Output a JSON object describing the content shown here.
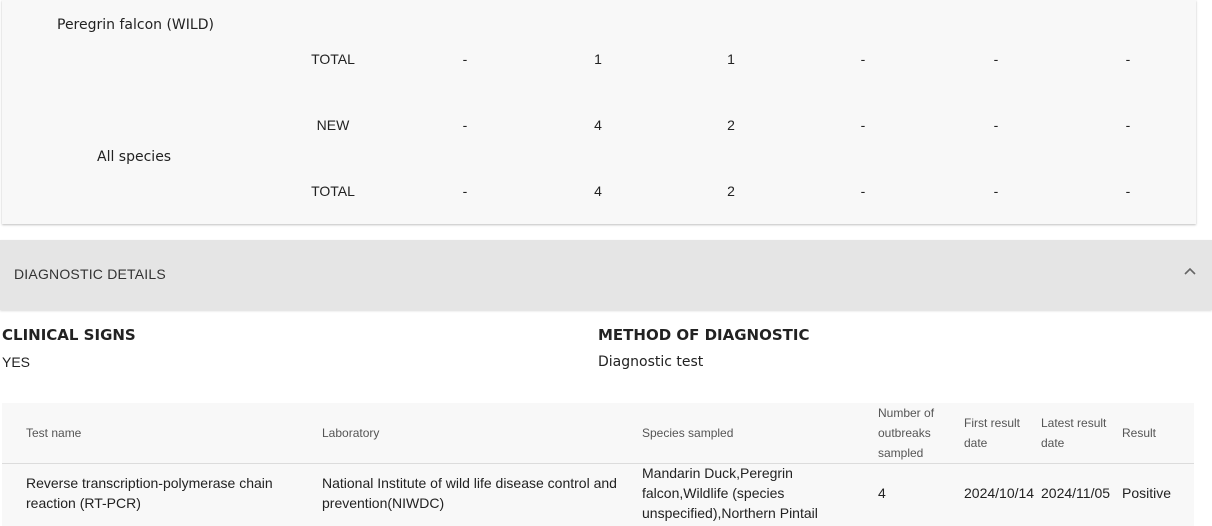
{
  "outbreak_table": {
    "rows": [
      {
        "species": "Peregrin falcon (WILD)",
        "type": "TOTAL",
        "values": [
          "-",
          "1",
          "1",
          "-",
          "-",
          "-"
        ]
      },
      {
        "species": "All species",
        "type": "NEW",
        "values": [
          "-",
          "4",
          "2",
          "-",
          "-",
          "-"
        ]
      },
      {
        "species": "",
        "type": "TOTAL",
        "values": [
          "-",
          "4",
          "2",
          "-",
          "-",
          "-"
        ]
      }
    ]
  },
  "diagnostic": {
    "section_title": "DIAGNOSTIC DETAILS",
    "expanded": true,
    "clinical_signs_label": "CLINICAL SIGNS",
    "clinical_signs_value": "YES",
    "method_label": "METHOD OF DIAGNOSTIC",
    "method_value": "Diagnostic test",
    "table": {
      "headers": {
        "test_name": "Test name",
        "laboratory": "Laboratory",
        "species_sampled": "Species sampled",
        "num_outbreaks_1": "Number of",
        "num_outbreaks_2": "outbreaks",
        "num_outbreaks_3": "sampled",
        "first_date_1": "First result",
        "first_date_2": "date",
        "latest_date_1": "Latest result",
        "latest_date_2": "date",
        "result": "Result"
      },
      "rows": [
        {
          "test_name_1": "Reverse transcription-polymerase chain",
          "test_name_2": "reaction (RT-PCR)",
          "laboratory_1": "National Institute of wild life disease control and",
          "laboratory_2": "prevention(NIWDC)",
          "species_1": "Mandarin Duck,Peregrin",
          "species_2": "falcon,Wildlife (species",
          "species_3": "unspecified),Northern Pintail",
          "num_outbreaks": "4",
          "first_date": "2024/10/14",
          "latest_date": "2024/11/05",
          "result": "Positive"
        }
      ]
    }
  }
}
